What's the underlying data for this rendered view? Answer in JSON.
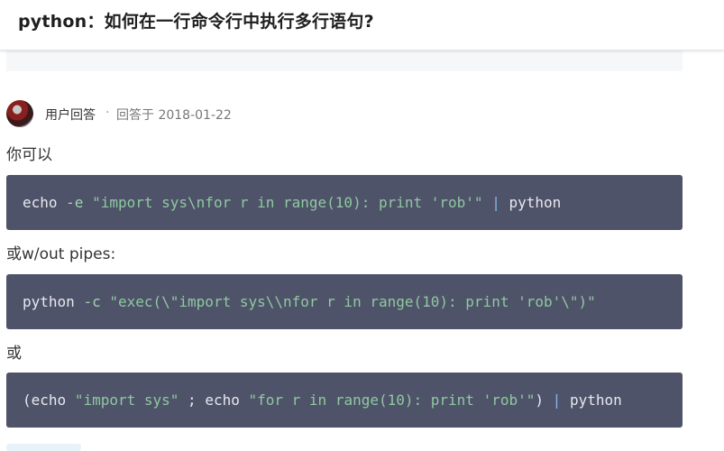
{
  "header": {
    "title": "python：如何在一行命令行中执行多行语句?"
  },
  "answer": {
    "user": "用户回答",
    "separator": "·",
    "date_text": "回答于 2018-01-22",
    "p1": "你可以",
    "code1": {
      "cmd": "echo",
      "flag": "-e",
      "str": "\"import sys\\nfor r in range(10): print 'rob'\"",
      "pipe": "|",
      "tail": "python"
    },
    "p2": "或w/out pipes:",
    "code2": {
      "cmd": "python",
      "flag": "-c",
      "str": "\"exec(\\\"import sys\\\\nfor r in range(10): print 'rob'\\\")\""
    },
    "p3": "或",
    "code3": {
      "open": "(echo",
      "str1": "\"import sys\"",
      "mid": "; echo",
      "str2": "\"for r in range(10): print 'rob'\"",
      "close": ")",
      "pipe": "|",
      "tail": "python"
    }
  },
  "colors": {
    "code_bg": "#4f5369",
    "code_string": "#8ec9a0",
    "code_pipe": "#7fb7e8"
  }
}
